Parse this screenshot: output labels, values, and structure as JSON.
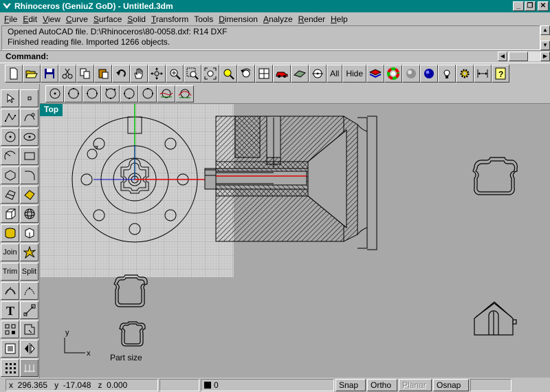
{
  "window": {
    "title": "Rhinoceros (GeniuZ GoD) - Untitled.3dm",
    "min_glyph": "_",
    "max_glyph": "❐",
    "close_glyph": "✕"
  },
  "menu": [
    {
      "underline": "F",
      "rest": "ile"
    },
    {
      "underline": "E",
      "rest": "dit"
    },
    {
      "underline": "V",
      "rest": "iew"
    },
    {
      "underline": "C",
      "rest": "urve"
    },
    {
      "underline": "S",
      "rest": "urface"
    },
    {
      "underline": "S",
      "rest": "olid"
    },
    {
      "underline": "T",
      "rest": "ransform"
    },
    {
      "underline": "",
      "rest": "Tools"
    },
    {
      "underline": "D",
      "rest": "imension"
    },
    {
      "underline": "A",
      "rest": "nalyze"
    },
    {
      "underline": "R",
      "rest": "ender"
    },
    {
      "underline": "H",
      "rest": "elp"
    }
  ],
  "history": {
    "line1": "Opened AutoCAD file.  D:\\Rhinoceros\\80-0058.dxf: R14 DXF",
    "line2": "Finished reading file.  Imported 1266 objects."
  },
  "command": {
    "label": "Command:"
  },
  "toolbar": {
    "all_label": "All",
    "hide_label": "Hide"
  },
  "left_toolbar": {
    "join_label": "Join",
    "trim_label": "Trim",
    "split_label": "Split"
  },
  "viewport": {
    "name": "Top",
    "part_label": "Part size",
    "axis_x": "x",
    "axis_y": "y"
  },
  "status": {
    "x_label": "x",
    "x_value": "296.365",
    "y_label": "y",
    "y_value": "-17.048",
    "z_label": "z",
    "z_value": "0.000",
    "layer": "0",
    "snap": "Snap",
    "ortho": "Ortho",
    "planar": "Planar",
    "osnap": "Osnap"
  },
  "colors": {
    "titlebar": "#008080",
    "viewport_bg": "#a8a8a8",
    "grid_area": "#c8c8c8",
    "x_axis": "#e00000",
    "y_axis": "#00c000"
  },
  "icons": {
    "std_toolbar": [
      "new-icon",
      "open-icon",
      "save-icon",
      "cut-icon",
      "copy-icon",
      "paste-icon",
      "undo-icon",
      "pan-hand-icon",
      "rotate-view-icon",
      "zoom-dynamic-icon",
      "zoom-window-icon",
      "zoom-extents-icon",
      "zoom-selected-icon",
      "undo-view-icon",
      "four-viewports-icon",
      "car-render-icon",
      "shade-icon",
      "point-icon",
      "color-icon",
      "color-wheel-icon",
      "render-preview-icon",
      "render-icon",
      "light-icon",
      "settings-icon",
      "dimension-icon",
      "help-icon"
    ],
    "circle_toolbar": [
      "circle-center-icon",
      "circle-3point-icon",
      "circle-diameter-icon",
      "circle-tangent-icon",
      "circle-tangent-tangent-icon",
      "circle-tangent-3-icon",
      "circle-curve-icon",
      "circle-around-curve-icon"
    ]
  }
}
